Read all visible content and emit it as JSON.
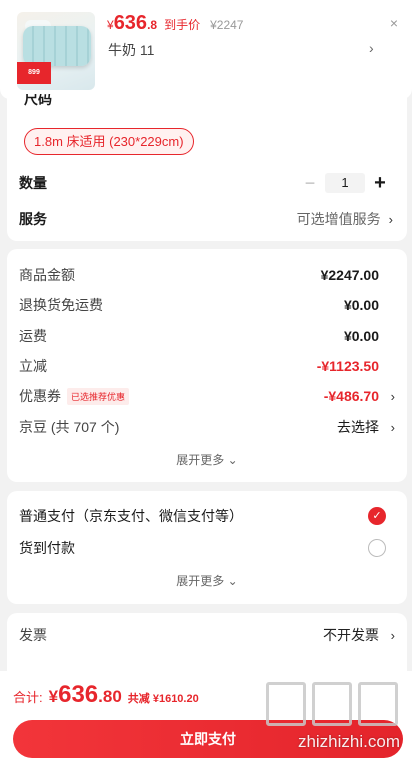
{
  "header": {
    "price_currency": "¥",
    "price_integer": "636",
    "price_decimal": ".8",
    "price_label": "到手价",
    "original_price": "¥2247",
    "variant_text": "牛奶  11",
    "thumb_tag": "899"
  },
  "spec": {
    "size_label_partial": "尺码",
    "size_chip": "1.8m 床适用 (230*229cm)",
    "quantity_label": "数量",
    "quantity_value": "1",
    "minus": "−",
    "plus": "+",
    "service_label": "服务",
    "service_value": "可选增值服务"
  },
  "amount": {
    "rows": [
      {
        "label": "商品金额",
        "value": "¥2247.00"
      },
      {
        "label": "退换货免运费",
        "value": "¥0.00"
      },
      {
        "label": "运费",
        "value": "¥0.00"
      },
      {
        "label": "立减",
        "value": "-¥1123.50"
      },
      {
        "label": "优惠券",
        "badge": "已选推荐优惠",
        "value": "-¥486.70"
      },
      {
        "label": "京豆 (共 707 个)",
        "value": "去选择"
      }
    ],
    "expand": "展开更多 ⌄"
  },
  "payment": {
    "option1": "普通支付（京东支付、微信支付等）",
    "option2": "货到付款",
    "expand": "展开更多 ⌄"
  },
  "invoice": {
    "label": "发票",
    "value": "不开发票"
  },
  "footer": {
    "total_label": "合计:",
    "total_currency": "¥",
    "total_integer": "636",
    "total_decimal": ".80",
    "savings": "共减 ¥1610.20",
    "pay_button": "立即支付",
    "watermark_url": "zhizhizhi.com"
  },
  "icons": {
    "close": "×",
    "chevron": "›",
    "check": "✓"
  },
  "colors": {
    "accent": "#e7262c"
  }
}
